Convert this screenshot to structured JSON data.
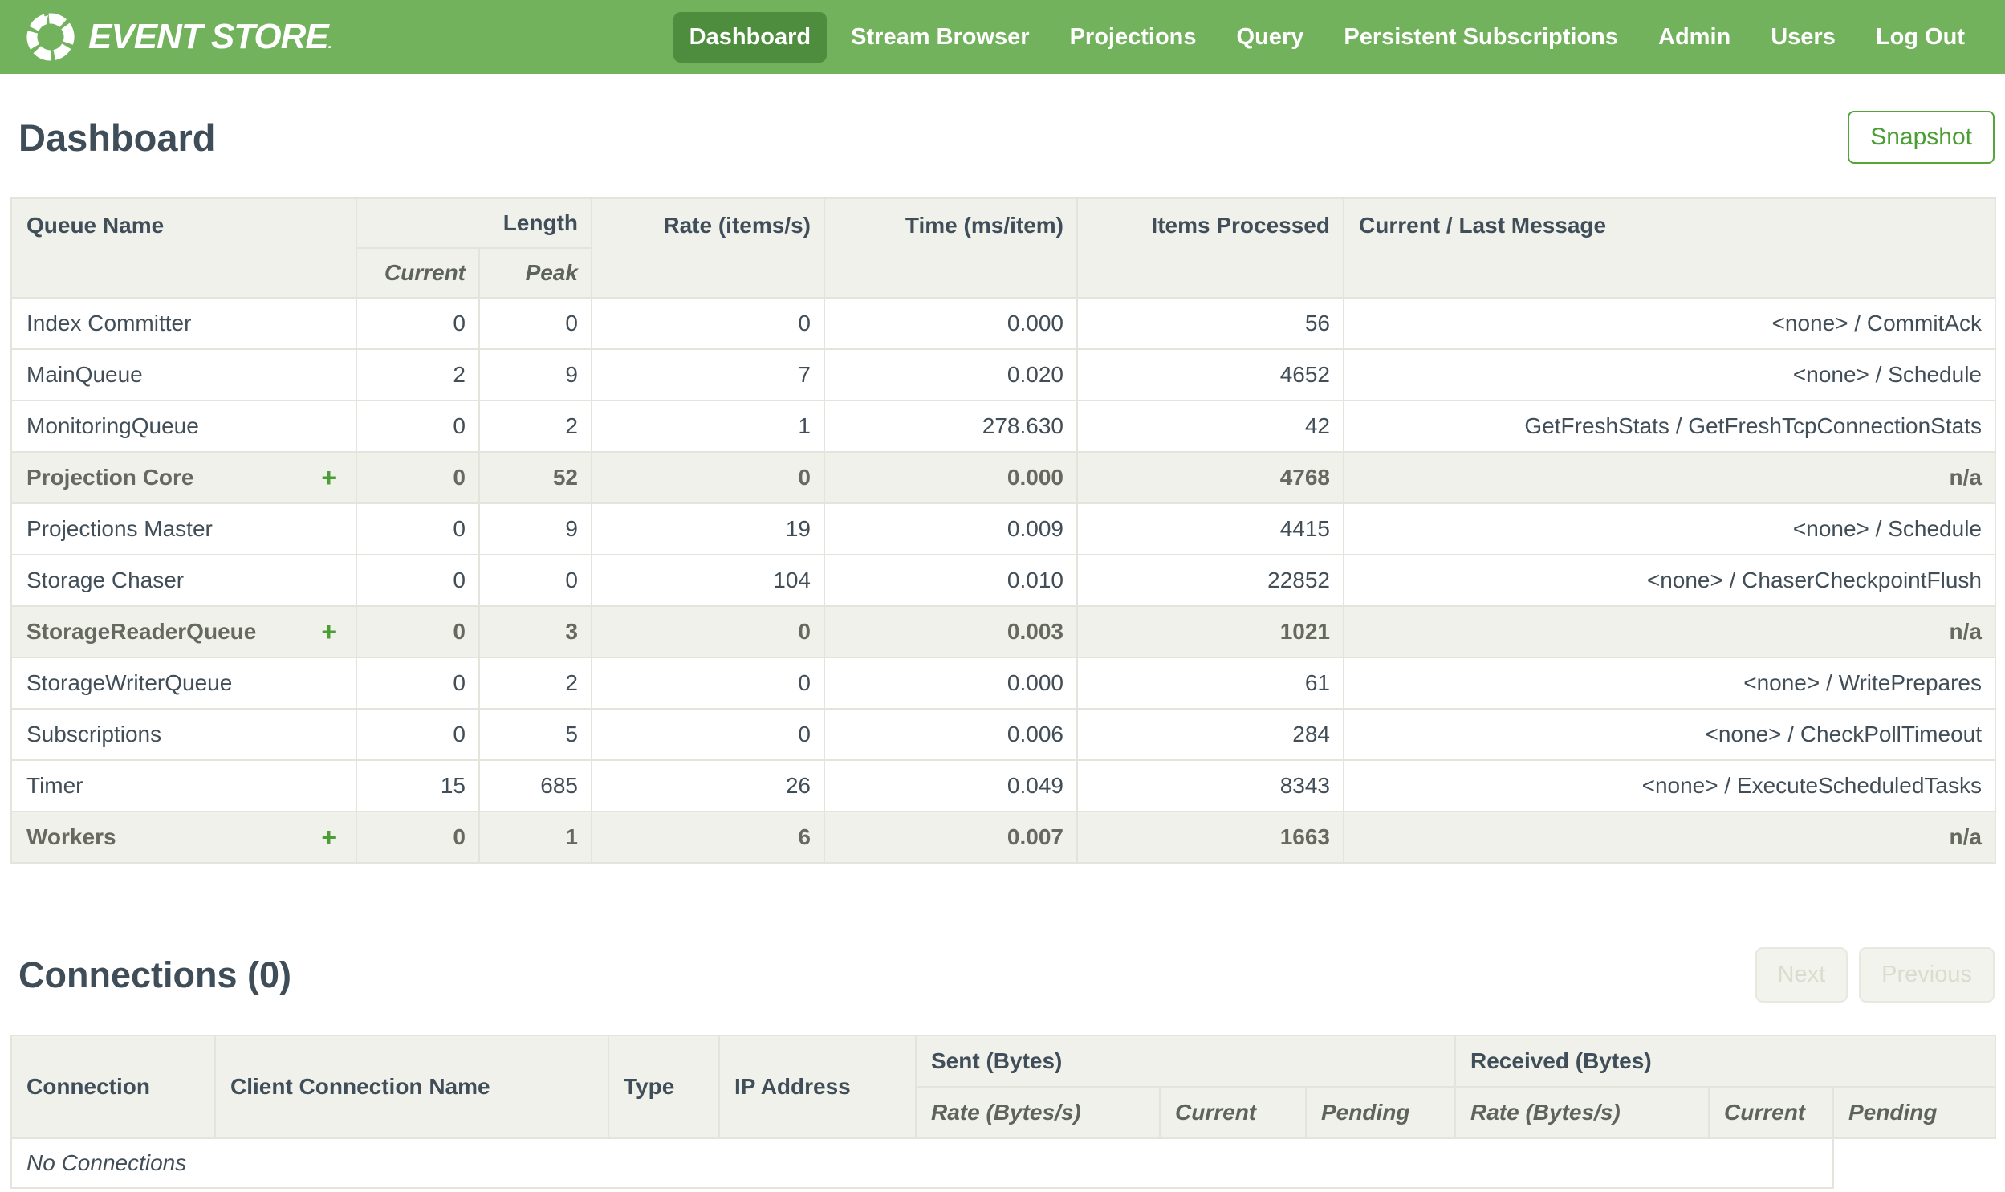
{
  "colors": {
    "brand_green": "#72b25d",
    "active_nav_green": "#4e8d3e",
    "accent_green": "#4a9e33"
  },
  "nav": {
    "logo_text": "EVENT STORE",
    "logo_mark": ".",
    "items": [
      {
        "label": "Dashboard",
        "active": true
      },
      {
        "label": "Stream Browser",
        "active": false
      },
      {
        "label": "Projections",
        "active": false
      },
      {
        "label": "Query",
        "active": false
      },
      {
        "label": "Persistent Subscriptions",
        "active": false
      },
      {
        "label": "Admin",
        "active": false
      },
      {
        "label": "Users",
        "active": false
      },
      {
        "label": "Log Out",
        "active": false
      }
    ]
  },
  "page": {
    "title": "Dashboard",
    "snapshot_button": "Snapshot"
  },
  "queues": {
    "headers": {
      "queue_name": "Queue Name",
      "length": "Length",
      "current": "Current",
      "peak": "Peak",
      "rate": "Rate (items/s)",
      "time": "Time (ms/item)",
      "items_processed": "Items Processed",
      "message": "Current / Last Message"
    },
    "expand_symbol": "+",
    "rows": [
      {
        "name": "Index Committer",
        "group": false,
        "current": "0",
        "peak": "0",
        "rate": "0",
        "time": "0.000",
        "items": "56",
        "message": "<none> / CommitAck"
      },
      {
        "name": "MainQueue",
        "group": false,
        "current": "2",
        "peak": "9",
        "rate": "7",
        "time": "0.020",
        "items": "4652",
        "message": "<none> / Schedule"
      },
      {
        "name": "MonitoringQueue",
        "group": false,
        "current": "0",
        "peak": "2",
        "rate": "1",
        "time": "278.630",
        "items": "42",
        "message": "GetFreshStats / GetFreshTcpConnectionStats"
      },
      {
        "name": "Projection Core",
        "group": true,
        "current": "0",
        "peak": "52",
        "rate": "0",
        "time": "0.000",
        "items": "4768",
        "message": "n/a"
      },
      {
        "name": "Projections Master",
        "group": false,
        "current": "0",
        "peak": "9",
        "rate": "19",
        "time": "0.009",
        "items": "4415",
        "message": "<none> / Schedule"
      },
      {
        "name": "Storage Chaser",
        "group": false,
        "current": "0",
        "peak": "0",
        "rate": "104",
        "time": "0.010",
        "items": "22852",
        "message": "<none> / ChaserCheckpointFlush"
      },
      {
        "name": "StorageReaderQueue",
        "group": true,
        "current": "0",
        "peak": "3",
        "rate": "0",
        "time": "0.003",
        "items": "1021",
        "message": "n/a"
      },
      {
        "name": "StorageWriterQueue",
        "group": false,
        "current": "0",
        "peak": "2",
        "rate": "0",
        "time": "0.000",
        "items": "61",
        "message": "<none> / WritePrepares"
      },
      {
        "name": "Subscriptions",
        "group": false,
        "current": "0",
        "peak": "5",
        "rate": "0",
        "time": "0.006",
        "items": "284",
        "message": "<none> / CheckPollTimeout"
      },
      {
        "name": "Timer",
        "group": false,
        "current": "15",
        "peak": "685",
        "rate": "26",
        "time": "0.049",
        "items": "8343",
        "message": "<none> / ExecuteScheduledTasks"
      },
      {
        "name": "Workers",
        "group": true,
        "current": "0",
        "peak": "1",
        "rate": "6",
        "time": "0.007",
        "items": "1663",
        "message": "n/a"
      }
    ]
  },
  "connections": {
    "title": "Connections (0)",
    "next_button": "Next",
    "previous_button": "Previous",
    "headers": {
      "connection": "Connection",
      "client_connection_name": "Client Connection Name",
      "type": "Type",
      "ip_address": "IP Address",
      "sent": "Sent (Bytes)",
      "received": "Received (Bytes)",
      "rate": "Rate (Bytes/s)",
      "current": "Current",
      "pending": "Pending"
    },
    "empty_message": "No Connections"
  }
}
